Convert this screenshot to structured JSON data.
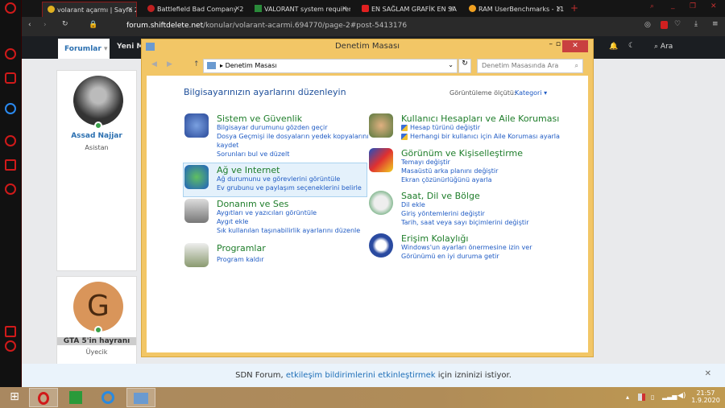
{
  "browser": {
    "tabs": [
      {
        "label": "volarant açarmı | Sayfa 2 | S",
        "active": true,
        "color": "#e0b020"
      },
      {
        "label": "Battlefield Bad Company 2",
        "active": false,
        "color": "#c02020"
      },
      {
        "label": "VALORANT system requirem",
        "active": false,
        "color": "#2a8a3a"
      },
      {
        "label": "EN SAĞLAM GRAFİK EN SA",
        "active": false,
        "color": "#e02020"
      },
      {
        "label": "RAM UserBenchmarks - 11",
        "active": false,
        "color": "#f0a020"
      }
    ],
    "url_domain": "forum.shiftdelete.net",
    "url_path": "/konular/volarant-acarmi.694770/page-2#post-5413176"
  },
  "site": {
    "nav": {
      "forums": "Forumlar",
      "new": "Yeni M",
      "search": "Ara"
    },
    "posts": [
      {
        "name": "Assad Najjar",
        "role": "Asistan"
      },
      {
        "name": "GTA 5'in hayranı",
        "role": "Üyecik",
        "initial": "G"
      }
    ]
  },
  "window": {
    "title": "Denetim Masası",
    "breadcrumb": "Denetim Masası",
    "search_placeholder": "Denetim Masasında Ara",
    "heading": "Bilgisayarınızın ayarlarını düzenleyin",
    "view_label": "Görüntüleme ölçütü:",
    "view_value": "Kategori",
    "left": [
      {
        "title": "Sistem ve Güvenlik",
        "links": [
          "Bilgisayar durumunu gözden geçir",
          "Dosya Geçmişi ile dosyaların yedek kopyalarını",
          "kaydet",
          "Sorunları bul ve düzelt"
        ]
      },
      {
        "title": "Ağ ve Internet",
        "links": [
          "Ağ durumunu ve görevlerini görüntüle",
          "Ev grubunu ve paylaşım seçeneklerini belirle"
        ]
      },
      {
        "title": "Donanım ve Ses",
        "links": [
          "Aygıtları ve yazıcıları görüntüle",
          "Aygıt ekle",
          "Sık kullanılan taşınabilirlik ayarlarını düzenle"
        ]
      },
      {
        "title": "Programlar",
        "links": [
          "Program kaldır"
        ]
      }
    ],
    "right": [
      {
        "title": "Kullanıcı Hesapları ve Aile Koruması",
        "links": [
          "Hesap türünü değiştir",
          "Herhangi bir kullanıcı için Aile Koruması ayarla"
        ]
      },
      {
        "title": "Görünüm ve Kişiselleştirme",
        "links": [
          "Temayı değiştir",
          "Masaüstü arka planını değiştir",
          "Ekran çözünürlüğünü ayarla"
        ]
      },
      {
        "title": "Saat, Dil ve Bölge",
        "links": [
          "Dil ekle",
          "Giriş yöntemlerini değiştir",
          "Tarih, saat veya sayı biçimlerini değiştir"
        ]
      },
      {
        "title": "Erişim Kolaylığı",
        "links": [
          "Windows'un ayarları önermesine izin ver",
          "Görünümü en iyi duruma getir"
        ]
      }
    ]
  },
  "notification": {
    "pre": "SDN Forum, ",
    "link": "etkileşim bildirimlerini etkinleştirmek",
    "post": " için izninizi istiyor."
  },
  "clock": {
    "time": "21:57",
    "date": "1.9.2020"
  }
}
